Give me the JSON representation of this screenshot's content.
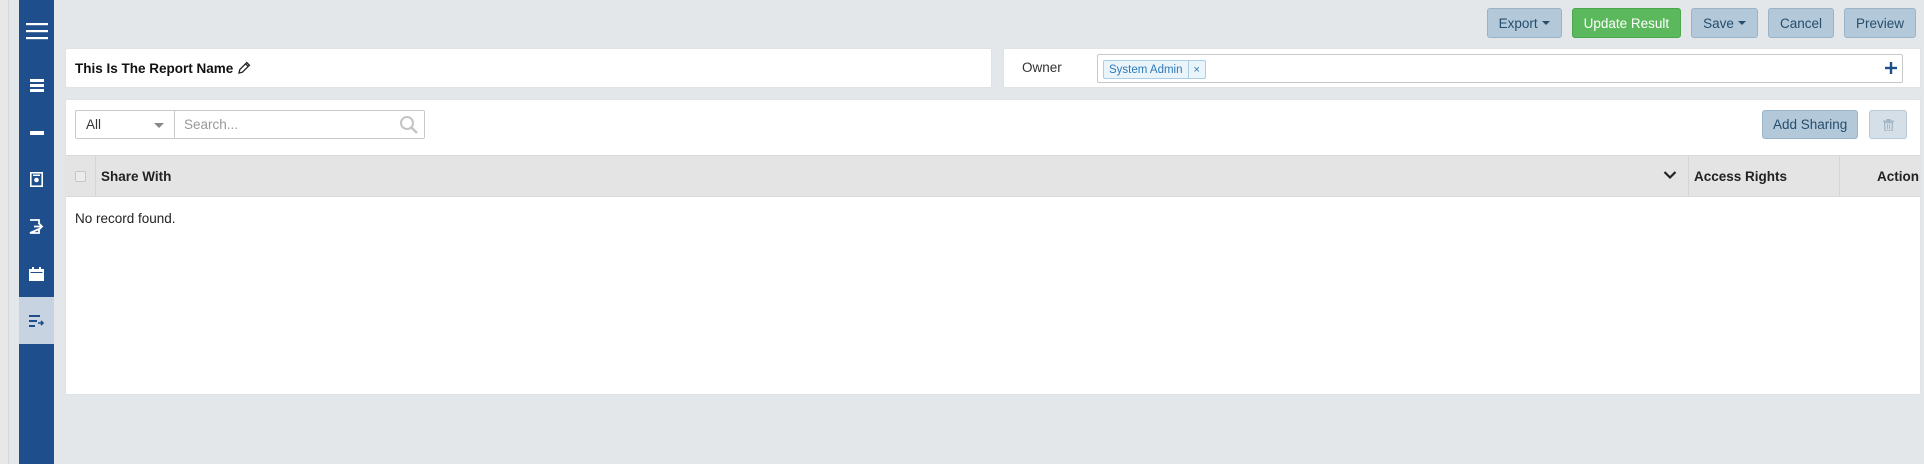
{
  "sidebar": {
    "items": [
      {
        "name": "menu",
        "icon": "hamburger-icon"
      },
      {
        "name": "list",
        "icon": "list-icon"
      },
      {
        "name": "minus",
        "icon": "minus-icon"
      },
      {
        "name": "report",
        "icon": "report-icon"
      },
      {
        "name": "export",
        "icon": "export-icon"
      },
      {
        "name": "calendar",
        "icon": "calendar-icon"
      },
      {
        "name": "sort",
        "icon": "sort-list-icon",
        "active": true
      }
    ]
  },
  "toolbar": {
    "export_label": "Export",
    "update_label": "Update Result",
    "save_label": "Save",
    "cancel_label": "Cancel",
    "preview_label": "Preview"
  },
  "report": {
    "name": "This Is The Report Name"
  },
  "owner": {
    "label": "Owner",
    "tag": "System Admin",
    "remove_glyph": "×"
  },
  "filter": {
    "selected": "All",
    "search_placeholder": "Search..."
  },
  "actions": {
    "add_sharing_label": "Add Sharing"
  },
  "table": {
    "columns": [
      "Share With",
      "Access Rights",
      "Action"
    ],
    "empty_message": "No record found."
  },
  "colors": {
    "sidebar": "#1f4e8c",
    "primary_button": "#b3c9da",
    "success_button": "#5cb85c",
    "tag_text": "#2f7ab5"
  }
}
